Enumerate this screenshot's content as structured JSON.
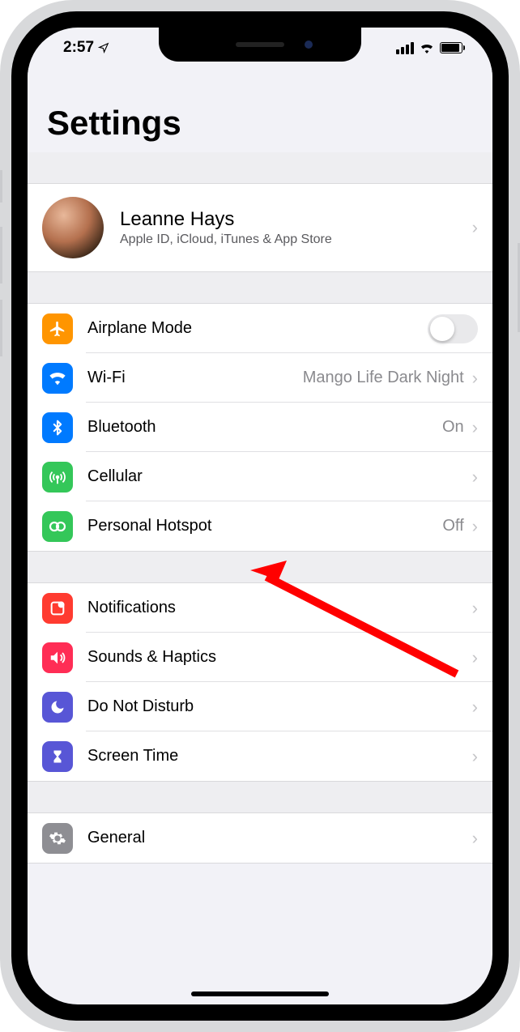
{
  "status": {
    "time": "2:57"
  },
  "title": "Settings",
  "profile": {
    "name": "Leanne Hays",
    "subtitle": "Apple ID, iCloud, iTunes & App Store"
  },
  "group1": {
    "airplane": {
      "label": "Airplane Mode",
      "color": "#ff9500"
    },
    "wifi": {
      "label": "Wi-Fi",
      "value": "Mango Life Dark Night",
      "color": "#007aff"
    },
    "bluetooth": {
      "label": "Bluetooth",
      "value": "On",
      "color": "#007aff"
    },
    "cellular": {
      "label": "Cellular",
      "color": "#34c759"
    },
    "hotspot": {
      "label": "Personal Hotspot",
      "value": "Off",
      "color": "#34c759"
    }
  },
  "group2": {
    "notifications": {
      "label": "Notifications",
      "color": "#ff3b30"
    },
    "sounds": {
      "label": "Sounds & Haptics",
      "color": "#ff2d55"
    },
    "dnd": {
      "label": "Do Not Disturb",
      "color": "#5856d6"
    },
    "screentime": {
      "label": "Screen Time",
      "color": "#5856d6"
    }
  },
  "group3": {
    "general": {
      "label": "General",
      "color": "#8e8e93"
    }
  }
}
